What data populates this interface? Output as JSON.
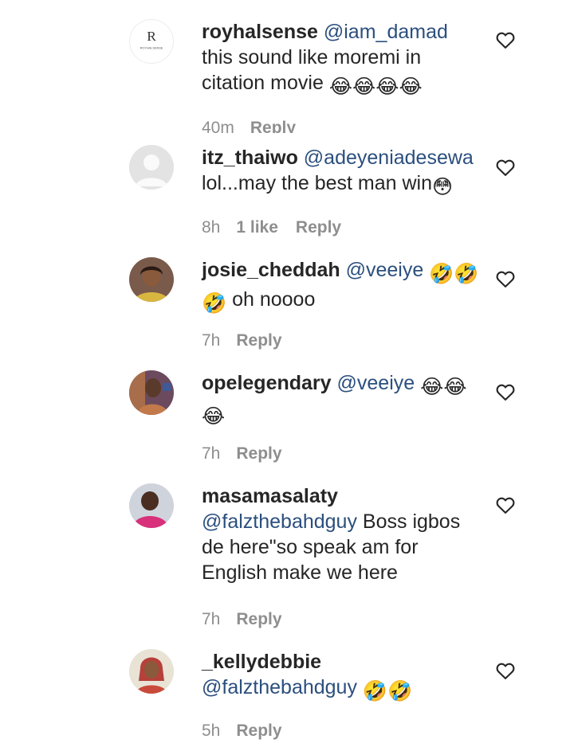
{
  "comments": [
    {
      "username": "royhalsense",
      "mention": "@iam_damad",
      "text": "this sound like moremi in citation movie",
      "emojis": [
        "😂",
        "😂",
        "😂",
        "😂"
      ],
      "time": "40m",
      "likes": "",
      "reply": "Reply",
      "avatar_text": "R",
      "avatar_caption": "ROYHALSENSE",
      "icon": "heart-outline-icon"
    },
    {
      "username": "itz_thaiwo",
      "mention": "@adeyeniadesewa",
      "text": "lol...may the best man win",
      "emojis": [
        "😳"
      ],
      "time": "8h",
      "likes": "1 like",
      "reply": "Reply",
      "icon": "heart-outline-icon"
    },
    {
      "username": "josie_cheddah",
      "mention": "@veeiye",
      "text": "oh noooo",
      "emojis": [
        "🤣",
        "🤣",
        "🤣"
      ],
      "time": "7h",
      "likes": "",
      "reply": "Reply",
      "icon": "heart-outline-icon"
    },
    {
      "username": "opelegendary",
      "mention": "@veeiye",
      "text": "",
      "emojis": [
        "😂",
        "😂",
        "😂"
      ],
      "time": "7h",
      "likes": "",
      "reply": "Reply",
      "icon": "heart-outline-icon"
    },
    {
      "username": "masamasalaty",
      "mention": "@falzthebahdguy",
      "text": "Boss igbos de here\"so speak am for English make we here",
      "emojis": [],
      "time": "7h",
      "likes": "",
      "reply": "Reply",
      "icon": "heart-outline-icon"
    },
    {
      "username": "_kellydebbie",
      "mention": "@falzthebahdguy",
      "text": "",
      "emojis": [
        "🤣",
        "🤣"
      ],
      "time": "5h",
      "likes": "",
      "reply": "Reply",
      "icon": "heart-outline-icon"
    }
  ],
  "colors": {
    "text": "#262626",
    "mention": "#2b4f7e",
    "meta": "#8e8e8e",
    "background": "#ffffff"
  }
}
